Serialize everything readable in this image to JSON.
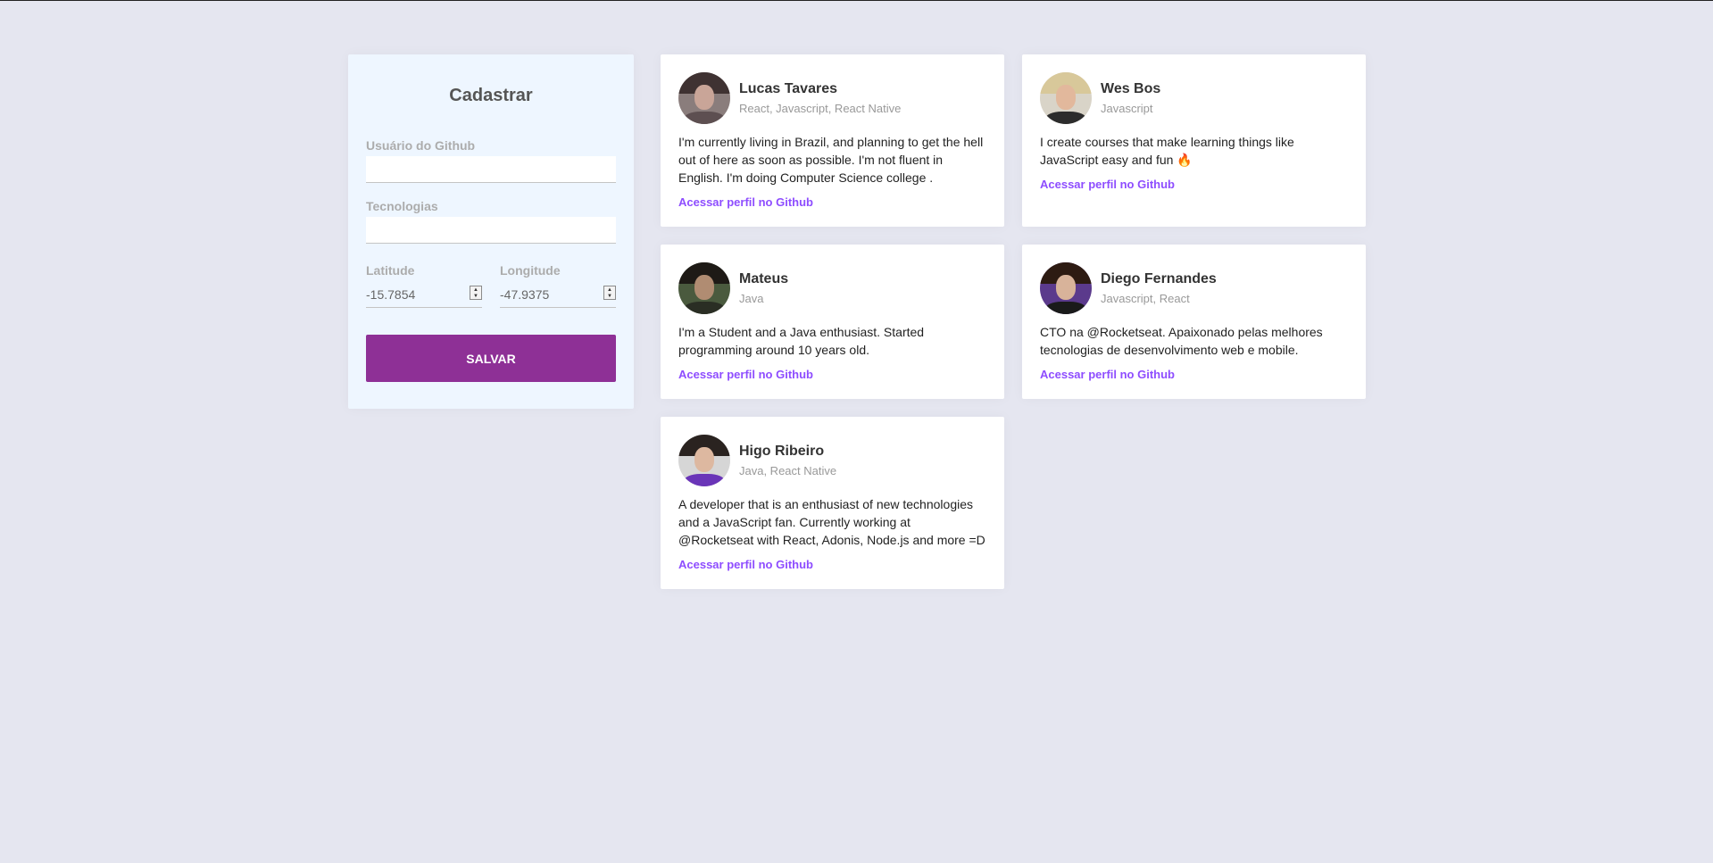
{
  "form": {
    "title": "Cadastrar",
    "github_label": "Usuário do Github",
    "github_value": "",
    "techs_label": "Tecnologias",
    "techs_value": "",
    "latitude_label": "Latitude",
    "latitude_value": "-15.7854",
    "longitude_label": "Longitude",
    "longitude_value": "-47.9375",
    "save_label": "SALVAR"
  },
  "devs": [
    {
      "name": "Lucas Tavares",
      "techs": "React, Javascript, React Native",
      "bio": "I'm currently living in Brazil, and planning to get the hell out of here as soon as possible. I'm not fluent in English. I'm doing Computer Science college .",
      "link": "Acessar perfil no Github",
      "avatar_colors": {
        "bg": "#8a7d7c",
        "hair": "#3f3232",
        "face": "#c9a598",
        "body": "#5d4f51"
      }
    },
    {
      "name": "Wes Bos",
      "techs": "Javascript",
      "bio": "I create courses that make learning things like JavaScript easy and fun 🔥",
      "link": "Acessar perfil no Github",
      "avatar_colors": {
        "bg": "#d9d4c8",
        "hair": "#d8c89a",
        "face": "#e2b89c",
        "body": "#2c2c2c"
      }
    },
    {
      "name": "Mateus",
      "techs": "Java",
      "bio": "I'm a Student and a Java enthusiast. Started programming around 10 years old.",
      "link": "Acessar perfil no Github",
      "avatar_colors": {
        "bg": "#4a5a3e",
        "hair": "#1e1a16",
        "face": "#b08c72",
        "body": "#2a2e24"
      }
    },
    {
      "name": "Diego Fernandes",
      "techs": "Javascript, React",
      "bio": "CTO na @Rocketseat. Apaixonado pelas melhores tecnologias de desenvolvimento web e mobile.",
      "link": "Acessar perfil no Github",
      "avatar_colors": {
        "bg": "#5b3a8c",
        "hair": "#2d1b12",
        "face": "#d8b39a",
        "body": "#1a1a1a"
      }
    },
    {
      "name": "Higo Ribeiro",
      "techs": "Java, React Native",
      "bio": "A developer that is an enthusiast of new technologies and a JavaScript fan. Currently working at @Rocketseat with React, Adonis, Node.js and more =D",
      "link": "Acessar perfil no Github",
      "avatar_colors": {
        "bg": "#d6d6d6",
        "hair": "#2a2320",
        "face": "#ddb8a0",
        "body": "#6a35b8"
      }
    }
  ],
  "colors": {
    "page_bg": "#e5e6f0",
    "form_bg": "#eef6ff",
    "accent_button": "#8e3096",
    "link": "#8e4dff"
  }
}
